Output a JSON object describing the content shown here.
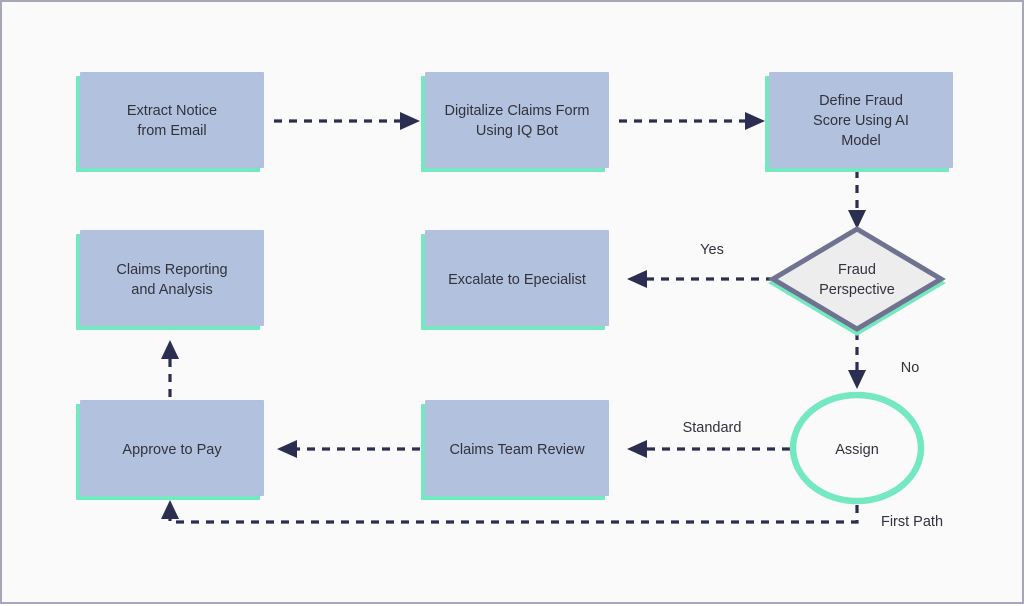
{
  "diagram": {
    "title": "Insurance Claims Processing Flowchart",
    "colors": {
      "canvas_background": "#fafafa",
      "canvas_border": "#a6a8b8",
      "process_fill": "#b2c1dd",
      "accent_shadow": "#74e8c0",
      "decision_fill": "#ededee",
      "decision_border": "#6f7390",
      "terminal_fill": "#fafafa",
      "edge_color": "#2b2d51",
      "text_color": "#32323c"
    },
    "nodes": [
      {
        "id": "extract-notice",
        "type": "process",
        "lines": [
          "Extract Notice",
          "from Email"
        ]
      },
      {
        "id": "digitalize-claims-form",
        "type": "process",
        "lines": [
          "Digitalize Claims Form",
          "Using IQ Bot"
        ]
      },
      {
        "id": "define-fraud-score",
        "type": "process",
        "lines": [
          "Define Fraud",
          "Score Using AI",
          "Model"
        ]
      },
      {
        "id": "fraud-perspective",
        "type": "decision",
        "lines": [
          "Fraud",
          "Perspective"
        ]
      },
      {
        "id": "escalate-to-specialist",
        "type": "process",
        "lines": [
          "Excalate to Epecialist"
        ]
      },
      {
        "id": "claims-reporting-analysis",
        "type": "process",
        "lines": [
          "Claims Reporting",
          "and Analysis"
        ]
      },
      {
        "id": "assign",
        "type": "terminal",
        "lines": [
          "Assign"
        ]
      },
      {
        "id": "claims-team-review",
        "type": "process",
        "lines": [
          "Claims Team Review"
        ]
      },
      {
        "id": "approve-to-pay",
        "type": "process",
        "lines": [
          "Approve to Pay"
        ]
      }
    ],
    "edge_labels": {
      "yes": "Yes",
      "no": "No",
      "standard": "Standard",
      "first_path": "First Path"
    }
  }
}
